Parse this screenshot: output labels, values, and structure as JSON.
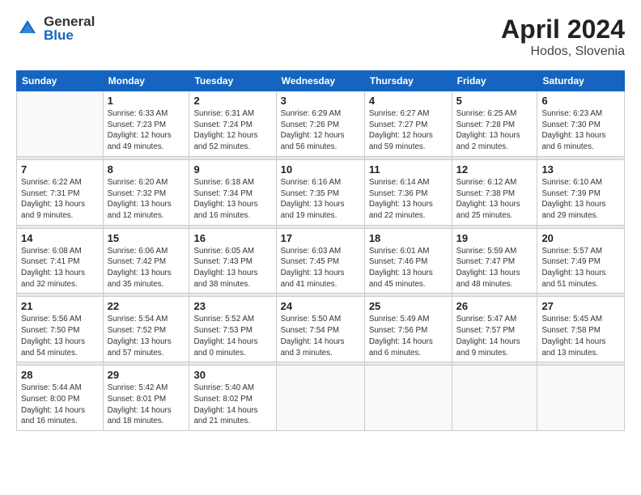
{
  "header": {
    "logo_general": "General",
    "logo_blue": "Blue",
    "title": "April 2024",
    "subtitle": "Hodos, Slovenia"
  },
  "weekdays": [
    "Sunday",
    "Monday",
    "Tuesday",
    "Wednesday",
    "Thursday",
    "Friday",
    "Saturday"
  ],
  "weeks": [
    [
      {
        "day": "",
        "info": ""
      },
      {
        "day": "1",
        "info": "Sunrise: 6:33 AM\nSunset: 7:23 PM\nDaylight: 12 hours\nand 49 minutes."
      },
      {
        "day": "2",
        "info": "Sunrise: 6:31 AM\nSunset: 7:24 PM\nDaylight: 12 hours\nand 52 minutes."
      },
      {
        "day": "3",
        "info": "Sunrise: 6:29 AM\nSunset: 7:26 PM\nDaylight: 12 hours\nand 56 minutes."
      },
      {
        "day": "4",
        "info": "Sunrise: 6:27 AM\nSunset: 7:27 PM\nDaylight: 12 hours\nand 59 minutes."
      },
      {
        "day": "5",
        "info": "Sunrise: 6:25 AM\nSunset: 7:28 PM\nDaylight: 13 hours\nand 2 minutes."
      },
      {
        "day": "6",
        "info": "Sunrise: 6:23 AM\nSunset: 7:30 PM\nDaylight: 13 hours\nand 6 minutes."
      }
    ],
    [
      {
        "day": "7",
        "info": "Sunrise: 6:22 AM\nSunset: 7:31 PM\nDaylight: 13 hours\nand 9 minutes."
      },
      {
        "day": "8",
        "info": "Sunrise: 6:20 AM\nSunset: 7:32 PM\nDaylight: 13 hours\nand 12 minutes."
      },
      {
        "day": "9",
        "info": "Sunrise: 6:18 AM\nSunset: 7:34 PM\nDaylight: 13 hours\nand 16 minutes."
      },
      {
        "day": "10",
        "info": "Sunrise: 6:16 AM\nSunset: 7:35 PM\nDaylight: 13 hours\nand 19 minutes."
      },
      {
        "day": "11",
        "info": "Sunrise: 6:14 AM\nSunset: 7:36 PM\nDaylight: 13 hours\nand 22 minutes."
      },
      {
        "day": "12",
        "info": "Sunrise: 6:12 AM\nSunset: 7:38 PM\nDaylight: 13 hours\nand 25 minutes."
      },
      {
        "day": "13",
        "info": "Sunrise: 6:10 AM\nSunset: 7:39 PM\nDaylight: 13 hours\nand 29 minutes."
      }
    ],
    [
      {
        "day": "14",
        "info": "Sunrise: 6:08 AM\nSunset: 7:41 PM\nDaylight: 13 hours\nand 32 minutes."
      },
      {
        "day": "15",
        "info": "Sunrise: 6:06 AM\nSunset: 7:42 PM\nDaylight: 13 hours\nand 35 minutes."
      },
      {
        "day": "16",
        "info": "Sunrise: 6:05 AM\nSunset: 7:43 PM\nDaylight: 13 hours\nand 38 minutes."
      },
      {
        "day": "17",
        "info": "Sunrise: 6:03 AM\nSunset: 7:45 PM\nDaylight: 13 hours\nand 41 minutes."
      },
      {
        "day": "18",
        "info": "Sunrise: 6:01 AM\nSunset: 7:46 PM\nDaylight: 13 hours\nand 45 minutes."
      },
      {
        "day": "19",
        "info": "Sunrise: 5:59 AM\nSunset: 7:47 PM\nDaylight: 13 hours\nand 48 minutes."
      },
      {
        "day": "20",
        "info": "Sunrise: 5:57 AM\nSunset: 7:49 PM\nDaylight: 13 hours\nand 51 minutes."
      }
    ],
    [
      {
        "day": "21",
        "info": "Sunrise: 5:56 AM\nSunset: 7:50 PM\nDaylight: 13 hours\nand 54 minutes."
      },
      {
        "day": "22",
        "info": "Sunrise: 5:54 AM\nSunset: 7:52 PM\nDaylight: 13 hours\nand 57 minutes."
      },
      {
        "day": "23",
        "info": "Sunrise: 5:52 AM\nSunset: 7:53 PM\nDaylight: 14 hours\nand 0 minutes."
      },
      {
        "day": "24",
        "info": "Sunrise: 5:50 AM\nSunset: 7:54 PM\nDaylight: 14 hours\nand 3 minutes."
      },
      {
        "day": "25",
        "info": "Sunrise: 5:49 AM\nSunset: 7:56 PM\nDaylight: 14 hours\nand 6 minutes."
      },
      {
        "day": "26",
        "info": "Sunrise: 5:47 AM\nSunset: 7:57 PM\nDaylight: 14 hours\nand 9 minutes."
      },
      {
        "day": "27",
        "info": "Sunrise: 5:45 AM\nSunset: 7:58 PM\nDaylight: 14 hours\nand 13 minutes."
      }
    ],
    [
      {
        "day": "28",
        "info": "Sunrise: 5:44 AM\nSunset: 8:00 PM\nDaylight: 14 hours\nand 16 minutes."
      },
      {
        "day": "29",
        "info": "Sunrise: 5:42 AM\nSunset: 8:01 PM\nDaylight: 14 hours\nand 18 minutes."
      },
      {
        "day": "30",
        "info": "Sunrise: 5:40 AM\nSunset: 8:02 PM\nDaylight: 14 hours\nand 21 minutes."
      },
      {
        "day": "",
        "info": ""
      },
      {
        "day": "",
        "info": ""
      },
      {
        "day": "",
        "info": ""
      },
      {
        "day": "",
        "info": ""
      }
    ]
  ]
}
